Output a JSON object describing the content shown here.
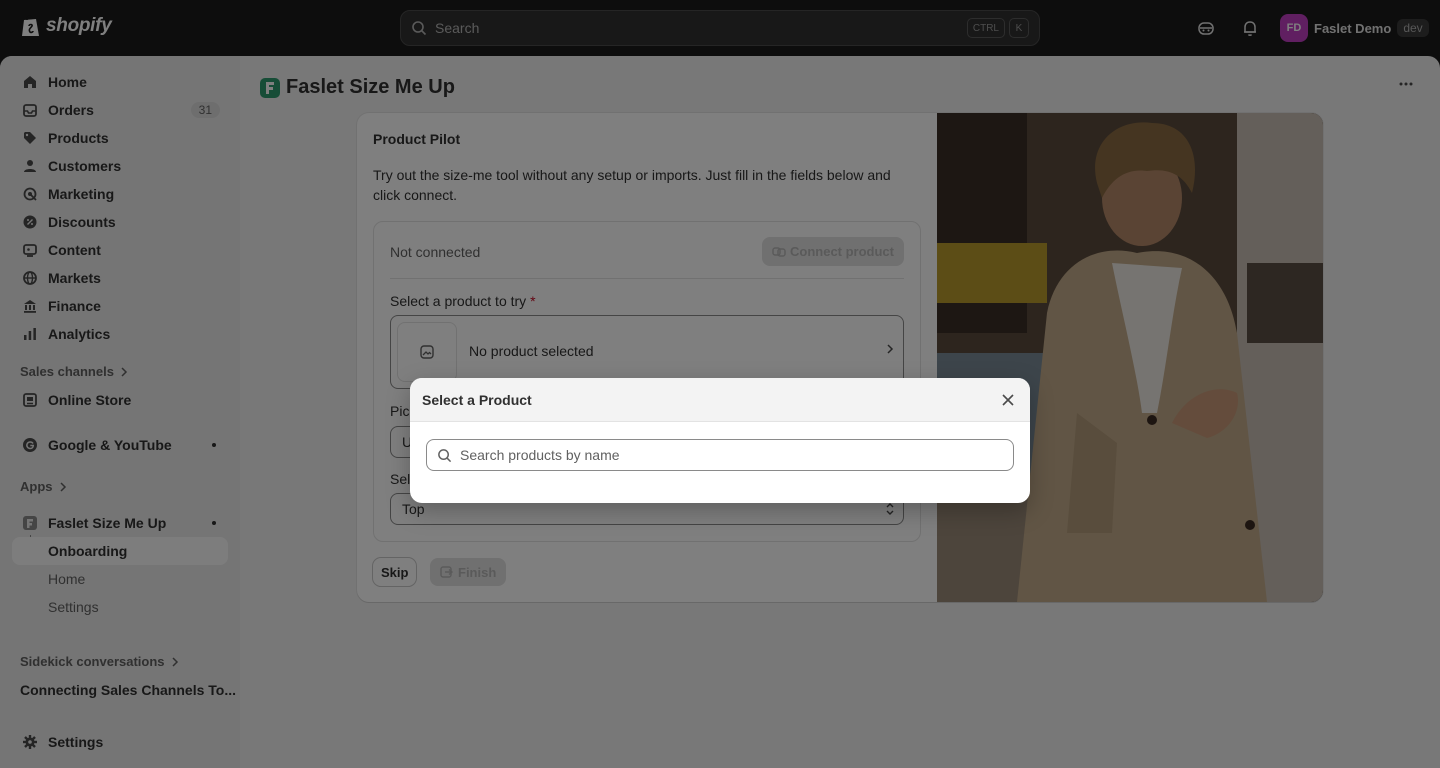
{
  "topbar": {
    "logo_text": "shopify",
    "search_placeholder": "Search",
    "shortcut_keys": [
      "CTRL",
      "K"
    ],
    "account": {
      "initials": "FD",
      "name": "Faslet Demo",
      "badge": "dev"
    }
  },
  "sidebar": {
    "items": [
      {
        "label": "Home",
        "icon": "home-icon"
      },
      {
        "label": "Orders",
        "icon": "orders-icon",
        "count": "31"
      },
      {
        "label": "Products",
        "icon": "tag-icon"
      },
      {
        "label": "Customers",
        "icon": "person-icon"
      },
      {
        "label": "Marketing",
        "icon": "target-icon"
      },
      {
        "label": "Discounts",
        "icon": "discount-icon"
      },
      {
        "label": "Content",
        "icon": "content-icon"
      },
      {
        "label": "Markets",
        "icon": "globe-icon"
      },
      {
        "label": "Finance",
        "icon": "bank-icon"
      },
      {
        "label": "Analytics",
        "icon": "chart-icon"
      }
    ],
    "sales_channels_label": "Sales channels",
    "online_store": "Online Store",
    "google_youtube": "Google & YouTube",
    "apps_label": "Apps",
    "app_name": "Faslet Size Me Up",
    "app_subitems": {
      "onboarding": "Onboarding",
      "home": "Home",
      "settings": "Settings"
    },
    "sidekick_label": "Sidekick conversations",
    "sidekick_item": "Connecting Sales Channels To...",
    "settings": "Settings"
  },
  "page": {
    "title": "Faslet Size Me Up"
  },
  "card": {
    "title": "Product Pilot",
    "description": "Try out the size-me tool without any setup or imports. Just fill in the fields below and click connect.",
    "status": "Not connected",
    "connect_label": "Connect product",
    "select_product_label": "Select a product to try",
    "required_mark": "*",
    "no_product": "No product selected",
    "pick_label": "Pic",
    "pick_value": "U",
    "select_label": "Sel",
    "select_value": "Top",
    "skip_label": "Skip",
    "finish_label": "Finish"
  },
  "modal": {
    "title": "Select a Product",
    "search_placeholder": "Search products by name"
  }
}
